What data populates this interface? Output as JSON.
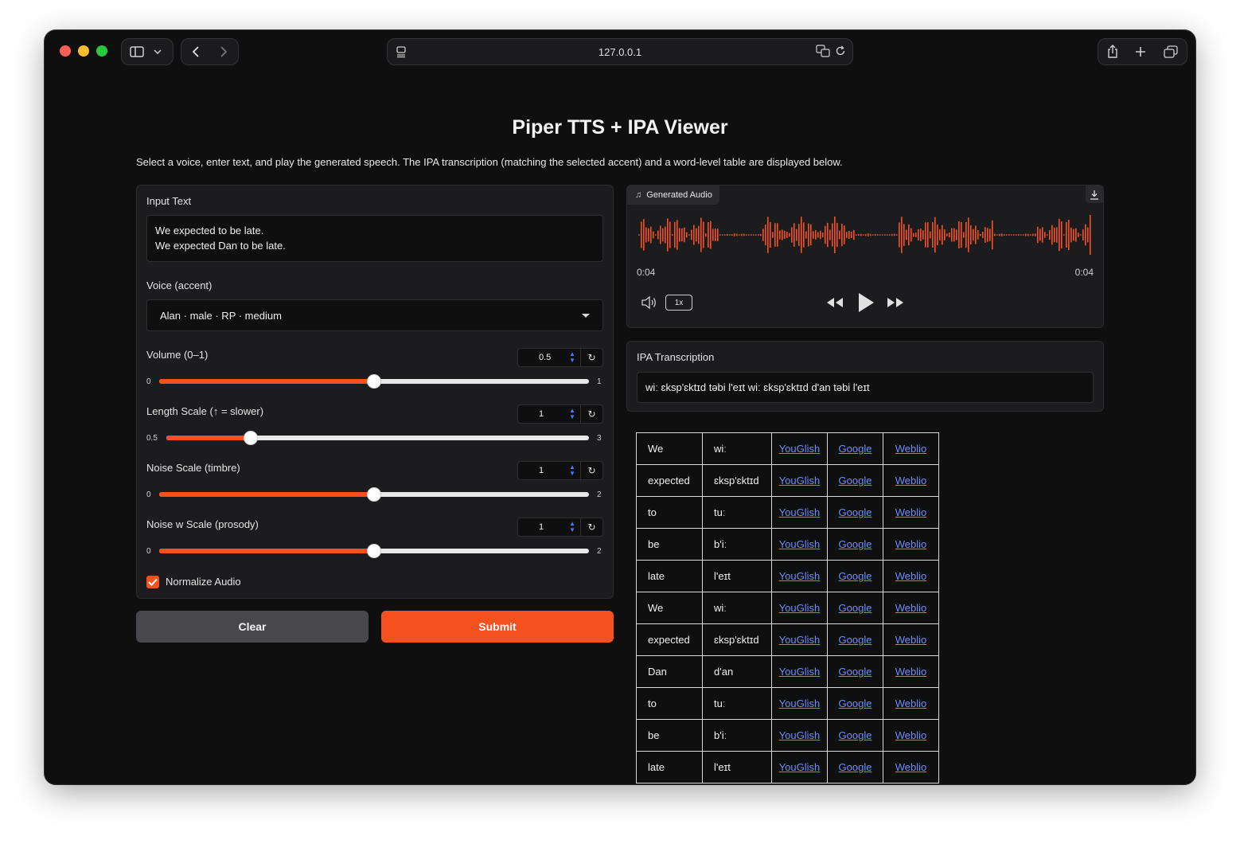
{
  "browser": {
    "url": "127.0.0.1"
  },
  "page": {
    "title": "Piper TTS + IPA Viewer",
    "description": "Select a voice, enter text, and play the generated speech. The IPA transcription (matching the selected accent) and a word-level table are displayed below."
  },
  "input_text": {
    "label": "Input Text",
    "line1": "We expected to be late.",
    "line2": "We expected Dan to be late."
  },
  "voice": {
    "label": "Voice (accent)",
    "selected": "Alan · male · RP · medium"
  },
  "sliders": {
    "volume": {
      "label": "Volume (0–1)",
      "value": "0.5",
      "min": "0",
      "max": "1",
      "fraction": 0.5
    },
    "length": {
      "label": "Length Scale (↑ = slower)",
      "value": "1",
      "min": "0.5",
      "max": "3",
      "fraction": 0.2
    },
    "noise": {
      "label": "Noise Scale (timbre)",
      "value": "1",
      "min": "0",
      "max": "2",
      "fraction": 0.5
    },
    "noise_w": {
      "label": "Noise w Scale (prosody)",
      "value": "1",
      "min": "0",
      "max": "2",
      "fraction": 0.5
    }
  },
  "normalize": {
    "label": "Normalize Audio",
    "checked": true
  },
  "buttons": {
    "clear": "Clear",
    "submit": "Submit"
  },
  "audio": {
    "label": "Generated Audio",
    "time_current": "0:04",
    "time_total": "0:04",
    "speed": "1x",
    "accent_color": "#f4511e"
  },
  "ipa": {
    "label": "IPA Transcription",
    "text": "wiː ɛksp'ɛktɪd təbi l'eɪt wiː ɛksp'ɛktɪd d'an təbi l'eɪt"
  },
  "word_table": {
    "link_labels": [
      "YouGlish",
      "Google",
      "Weblio"
    ],
    "rows": [
      {
        "word": "We",
        "ipa": "wiː"
      },
      {
        "word": "expected",
        "ipa": "ɛksp'ɛktɪd"
      },
      {
        "word": "to",
        "ipa": "tuː"
      },
      {
        "word": "be",
        "ipa": "b'iː"
      },
      {
        "word": "late",
        "ipa": "l'eɪt"
      },
      {
        "word": "We",
        "ipa": "wiː"
      },
      {
        "word": "expected",
        "ipa": "ɛksp'ɛktɪd"
      },
      {
        "word": "Dan",
        "ipa": "d'an"
      },
      {
        "word": "to",
        "ipa": "tuː"
      },
      {
        "word": "be",
        "ipa": "b'iː"
      },
      {
        "word": "late",
        "ipa": "l'eɪt"
      }
    ]
  }
}
